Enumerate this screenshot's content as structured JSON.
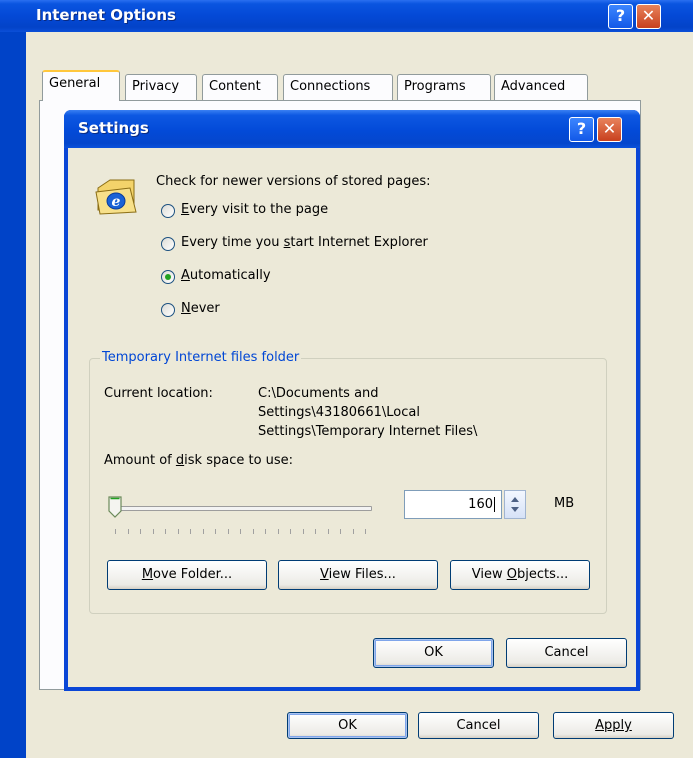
{
  "outer_window": {
    "title": "Internet Options",
    "help_glyph": "?",
    "close_glyph": "✕",
    "tabs": [
      "General",
      "Privacy",
      "Content",
      "Connections",
      "Programs",
      "Advanced"
    ],
    "buttons": {
      "ok": "OK",
      "cancel": "Cancel",
      "apply": "Apply"
    }
  },
  "settings_dialog": {
    "title": "Settings",
    "help_glyph": "?",
    "close_glyph": "✕",
    "check_heading": "Check for newer versions of stored pages:",
    "radio_options": [
      {
        "label": "Every visit to the page",
        "checked": false
      },
      {
        "label": "Every time you start Internet Explorer",
        "checked": false
      },
      {
        "label": "Automatically",
        "checked": true
      },
      {
        "label": "Never",
        "checked": false
      }
    ],
    "group_title": "Temporary Internet files folder",
    "current_location_label": "Current location:",
    "current_location_lines": [
      "C:\\Documents and",
      "Settings\\43180661\\Local",
      "Settings\\Temporary Internet Files\\"
    ],
    "disk_space_label": "Amount of disk space to use:",
    "disk_space_value": "160",
    "disk_space_unit": "MB",
    "slider_level": 0.0,
    "folder_buttons": {
      "move": "Move Folder...",
      "view_files": "View Files...",
      "view_objects": "View Objects..."
    },
    "buttons": {
      "ok": "OK",
      "cancel": "Cancel"
    }
  },
  "colors": {
    "titlebar": "#0449d6",
    "face": "#ece9d8",
    "group_title": "#0046d5",
    "radio_dot": "#21a121"
  }
}
